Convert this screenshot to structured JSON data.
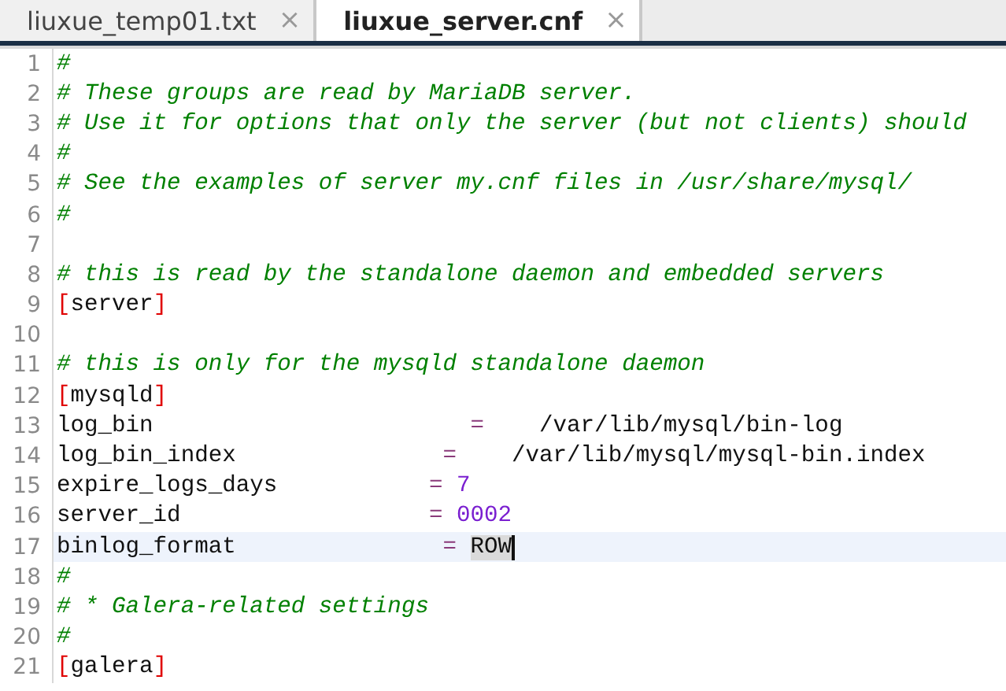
{
  "tabs": [
    {
      "label": "liuxue_temp01.txt",
      "selected": false,
      "close": "×"
    },
    {
      "label": "liuxue_server.cnf",
      "selected": true,
      "close": "×"
    }
  ],
  "editor": {
    "lines": [
      {
        "number": "1",
        "kind": "comment",
        "text": "#",
        "current": false
      },
      {
        "number": "2",
        "kind": "comment",
        "text": "# These groups are read by MariaDB server.",
        "current": false
      },
      {
        "number": "3",
        "kind": "comment",
        "text": "# Use it for options that only the server (but not clients) should",
        "current": false
      },
      {
        "number": "4",
        "kind": "comment",
        "text": "#",
        "current": false
      },
      {
        "number": "5",
        "kind": "comment",
        "text": "# See the examples of server my.cnf files in /usr/share/mysql/",
        "current": false
      },
      {
        "number": "6",
        "kind": "comment",
        "text": "#",
        "current": false
      },
      {
        "number": "7",
        "kind": "blank",
        "current": false
      },
      {
        "number": "8",
        "kind": "comment",
        "text": "# this is read by the standalone daemon and embedded servers",
        "current": false
      },
      {
        "number": "9",
        "kind": "section",
        "open": "[",
        "name": "server",
        "close": "]",
        "current": false
      },
      {
        "number": "10",
        "kind": "blank",
        "current": false
      },
      {
        "number": "11",
        "kind": "comment",
        "text": "# this is only for the mysqld standalone daemon",
        "current": false
      },
      {
        "number": "12",
        "kind": "section",
        "open": "[",
        "name": "mysqld",
        "close": "]",
        "current": false
      },
      {
        "number": "13",
        "kind": "setting",
        "key": "log_bin                       ",
        "eq": "=    ",
        "value": {
          "kind": "text",
          "text": "/var/lib/mysql/bin-log"
        },
        "value_selected": false,
        "current": false
      },
      {
        "number": "14",
        "kind": "setting",
        "key": "log_bin_index               ",
        "eq": "=    ",
        "value": {
          "kind": "text",
          "text": "/var/lib/mysql/mysql-bin.index"
        },
        "value_selected": false,
        "current": false
      },
      {
        "number": "15",
        "kind": "setting",
        "key": "expire_logs_days           ",
        "eq": "= ",
        "value": {
          "kind": "number",
          "text": "7"
        },
        "value_selected": false,
        "current": false
      },
      {
        "number": "16",
        "kind": "setting",
        "key": "server_id                  ",
        "eq": "= ",
        "value": {
          "kind": "number",
          "text": "0002"
        },
        "value_selected": false,
        "current": false
      },
      {
        "number": "17",
        "kind": "setting",
        "key": "binlog_format               ",
        "eq": "= ",
        "value": {
          "kind": "text",
          "text": "ROW"
        },
        "value_selected": true,
        "current": true
      },
      {
        "number": "18",
        "kind": "comment",
        "text": "#",
        "current": false
      },
      {
        "number": "19",
        "kind": "comment",
        "text": "# * Galera-related settings",
        "current": false
      },
      {
        "number": "20",
        "kind": "comment",
        "text": "#",
        "current": false
      },
      {
        "number": "21",
        "kind": "section",
        "open": "[",
        "name": "galera",
        "close": "]",
        "current": false
      }
    ]
  }
}
